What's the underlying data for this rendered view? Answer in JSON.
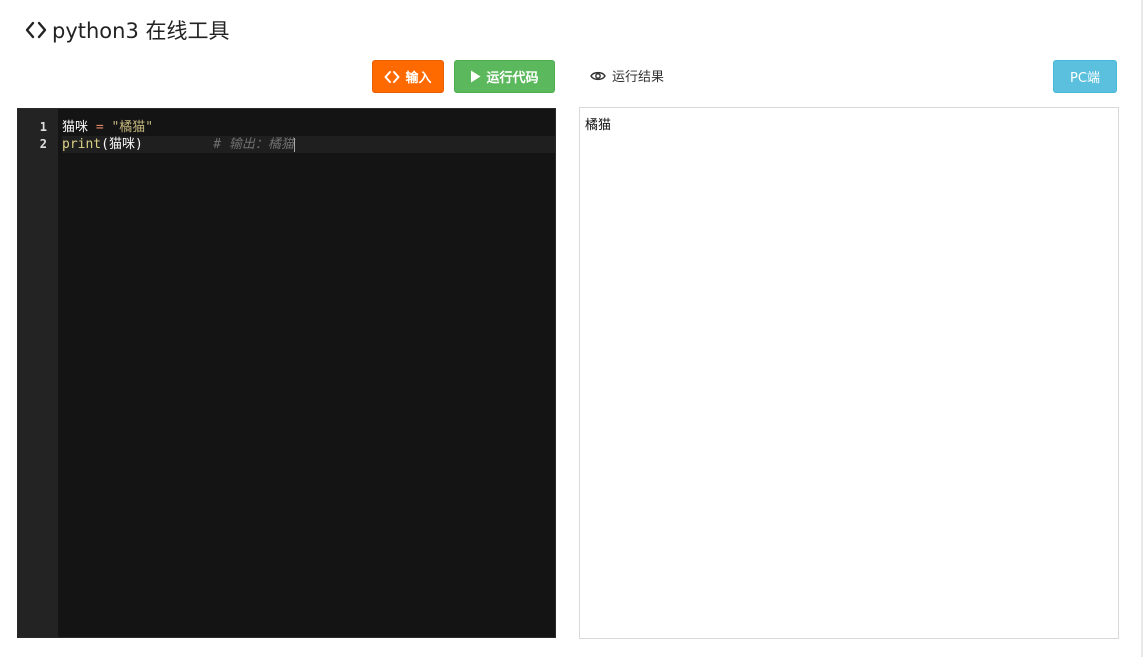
{
  "header": {
    "title": "python3 在线工具"
  },
  "toolbar": {
    "input_label": "输入",
    "run_label": "运行代码",
    "result_label": "运行结果",
    "pc_label": "PC端"
  },
  "editor": {
    "line_numbers": [
      "1",
      "2"
    ],
    "line1": {
      "var": "猫咪 ",
      "op": "=",
      "space": " ",
      "str": "\"橘猫\""
    },
    "line2": {
      "fn": "print",
      "args": "(猫咪)",
      "pad": "         ",
      "comment": "# 输出：橘猫"
    }
  },
  "output": {
    "text": "橘猫"
  },
  "colors": {
    "input_button": "#ff6a00",
    "run_button": "#5cb85c",
    "pc_button": "#5bc0de",
    "editor_bg": "#141414"
  },
  "icons": {
    "title": "code-brackets-icon",
    "input_button": "code-brackets-icon",
    "run_button": "play-icon",
    "result": "eye-icon"
  }
}
